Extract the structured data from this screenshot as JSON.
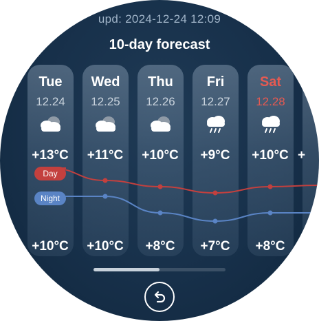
{
  "header": {
    "updated_text": "upd: 2024-12-24 12:09",
    "title": "10-day forecast"
  },
  "days": [
    {
      "day": "Tue",
      "date": "12.24",
      "icon": "cloudy-icon",
      "high": "+13°C",
      "low": "+10°C",
      "high_value": 13,
      "low_value": 10,
      "weekend": false
    },
    {
      "day": "Wed",
      "date": "12.25",
      "icon": "cloudy-icon",
      "high": "+11°C",
      "low": "+10°C",
      "high_value": 11,
      "low_value": 10,
      "weekend": false
    },
    {
      "day": "Thu",
      "date": "12.26",
      "icon": "cloudy-icon",
      "high": "+10°C",
      "low": "+8°C",
      "high_value": 10,
      "low_value": 8,
      "weekend": false
    },
    {
      "day": "Fri",
      "date": "12.27",
      "icon": "rain-icon",
      "high": "+9°C",
      "low": "+7°C",
      "high_value": 9,
      "low_value": 7,
      "weekend": false
    },
    {
      "day": "Sat",
      "date": "12.28",
      "icon": "rain-icon",
      "high": "+10°C",
      "low": "+8°C",
      "high_value": 10,
      "low_value": 8,
      "weekend": true
    }
  ],
  "legend": {
    "day_label": "Day",
    "night_label": "Night",
    "day_color": "#c3403e",
    "night_color": "#5a84c5"
  },
  "scroll": {
    "position_fraction": 0.5
  },
  "controls": {
    "back_icon": "undo-arrow-icon"
  }
}
